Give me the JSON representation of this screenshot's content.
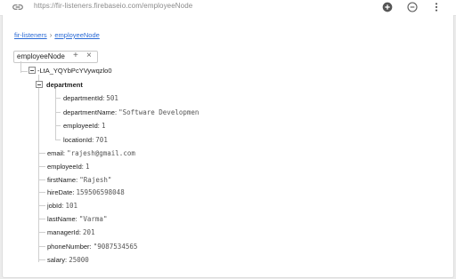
{
  "toolbar": {
    "url": "https://fir-listeners.firebaseio.com/employeeNode",
    "icons": [
      "link-icon",
      "add-circle-icon",
      "remove-circle-icon",
      "more-vert-icon"
    ]
  },
  "breadcrumb": {
    "items": [
      "fir-listeners",
      "employeeNode"
    ],
    "separator": "›"
  },
  "chip": {
    "label": "employeeNode",
    "add_symbol": "+",
    "close_symbol": "×"
  },
  "tree": {
    "root_key": "-LtA_YQYbPcYVywqzlo0",
    "department": {
      "key": "department",
      "fields": [
        {
          "key": "departmentId:",
          "value": "501"
        },
        {
          "key": "departmentName:",
          "value": "\"Software Developmen"
        },
        {
          "key": "employeeId:",
          "value": "1"
        },
        {
          "key": "locationId:",
          "value": "701"
        }
      ]
    },
    "fields": [
      {
        "key": "email:",
        "value": "\"rajesh@gmail.com"
      },
      {
        "key": "employeeId:",
        "value": "1"
      },
      {
        "key": "firstName:",
        "value": "\"Rajesh\""
      },
      {
        "key": "hireDate:",
        "value": "159506598048"
      },
      {
        "key": "jobId:",
        "value": "101"
      },
      {
        "key": "lastName:",
        "value": "\"Varma\""
      },
      {
        "key": "managerId:",
        "value": "201"
      },
      {
        "key": "phoneNumber:",
        "value": "\"9087534565"
      },
      {
        "key": "salary:",
        "value": "25000"
      }
    ]
  }
}
